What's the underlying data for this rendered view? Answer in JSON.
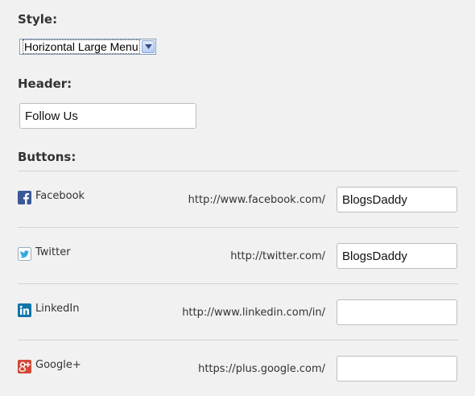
{
  "style": {
    "label": "Style:",
    "selected": "Horizontal Large Menu"
  },
  "header": {
    "label": "Header:",
    "value": "Follow Us"
  },
  "buttons": {
    "label": "Buttons:",
    "items": [
      {
        "name": "Facebook",
        "prefix": "http://www.facebook.com/",
        "value": "BlogsDaddy",
        "icon": "facebook-icon",
        "color": "#3b5998"
      },
      {
        "name": "Twitter",
        "prefix": "http://twitter.com/",
        "value": "BlogsDaddy",
        "icon": "twitter-icon",
        "color": "#33aadd"
      },
      {
        "name": "LinkedIn",
        "prefix": "http://www.linkedin.com/in/",
        "value": "",
        "icon": "linkedin-icon",
        "color": "#0e76a8"
      },
      {
        "name": "Google+",
        "prefix": "https://plus.google.com/",
        "value": "",
        "icon": "google-plus-icon",
        "color": "#d34836"
      }
    ]
  }
}
